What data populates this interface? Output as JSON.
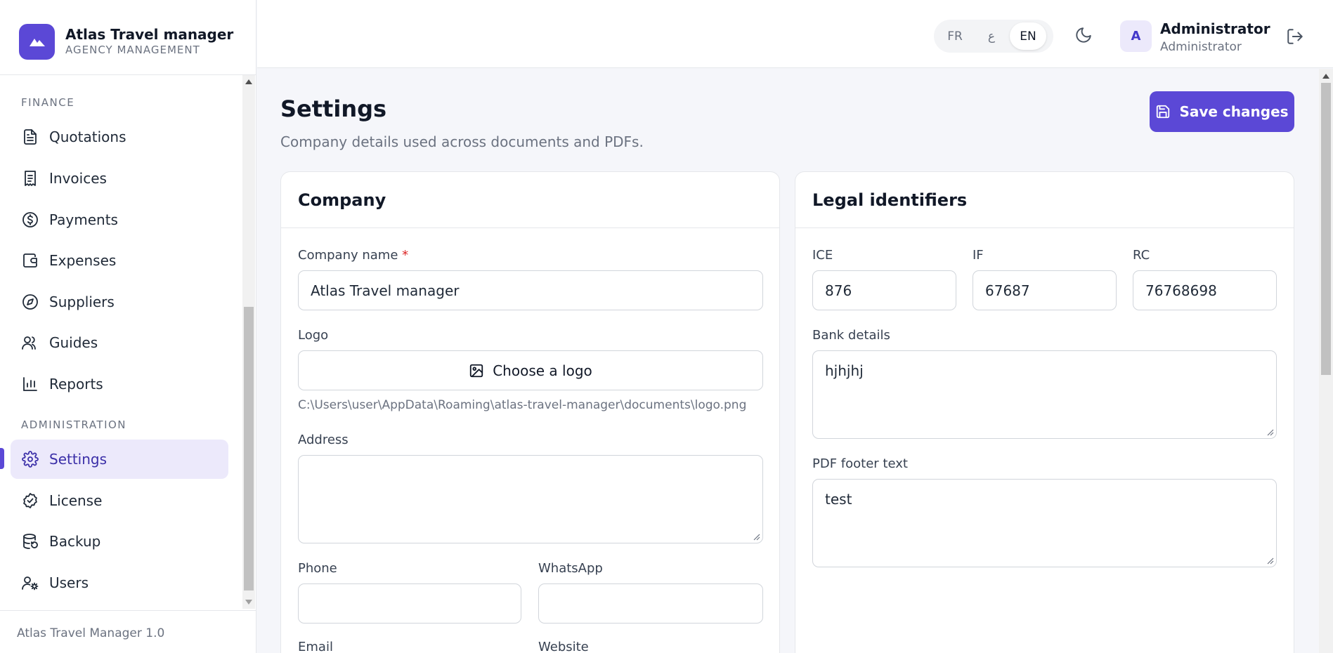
{
  "app": {
    "title": "Atlas Travel manager",
    "subtitle": "AGENCY MANAGEMENT",
    "version": "Atlas Travel Manager 1.0"
  },
  "colors": {
    "accent": "#5b48d6",
    "accent_soft": "#ece9fb"
  },
  "sidebar": {
    "finance_label": "FINANCE",
    "admin_label": "ADMINISTRATION",
    "items": [
      {
        "label": "Quotations",
        "icon": "document-icon"
      },
      {
        "label": "Invoices",
        "icon": "receipt-icon"
      },
      {
        "label": "Payments",
        "icon": "dollar-circle-icon"
      },
      {
        "label": "Expenses",
        "icon": "wallet-icon"
      },
      {
        "label": "Suppliers",
        "icon": "compass-icon"
      },
      {
        "label": "Guides",
        "icon": "users-icon"
      },
      {
        "label": "Reports",
        "icon": "bar-chart-icon"
      },
      {
        "label": "Settings",
        "icon": "gear-icon",
        "active": true
      },
      {
        "label": "License",
        "icon": "badge-check-icon"
      },
      {
        "label": "Backup",
        "icon": "database-icon"
      },
      {
        "label": "Users",
        "icon": "user-cog-icon"
      }
    ]
  },
  "topbar": {
    "languages": [
      "FR",
      "ع",
      "EN"
    ],
    "active_language": "EN",
    "user_initial": "A",
    "user_name": "Administrator",
    "user_role": "Administrator"
  },
  "page": {
    "title": "Settings",
    "subtitle": "Company details used across documents and PDFs.",
    "save_label": "Save changes"
  },
  "company": {
    "title": "Company",
    "name_label": "Company name",
    "name_required": "*",
    "name_value": "Atlas Travel manager",
    "logo_label": "Logo",
    "logo_button": "Choose a logo",
    "logo_path": "C:\\Users\\user\\AppData\\Roaming\\atlas-travel-manager\\documents\\logo.png",
    "address_label": "Address",
    "address_value": "",
    "phone_label": "Phone",
    "phone_value": "",
    "whatsapp_label": "WhatsApp",
    "whatsapp_value": "",
    "email_label": "Email",
    "website_label": "Website"
  },
  "legal": {
    "title": "Legal identifiers",
    "ice_label": "ICE",
    "ice_value": "876",
    "if_label": "IF",
    "if_value": "67687",
    "rc_label": "RC",
    "rc_value": "76768698",
    "bank_label": "Bank details",
    "bank_value": "hjhjhj",
    "footer_label": "PDF footer text",
    "footer_value": "test"
  }
}
